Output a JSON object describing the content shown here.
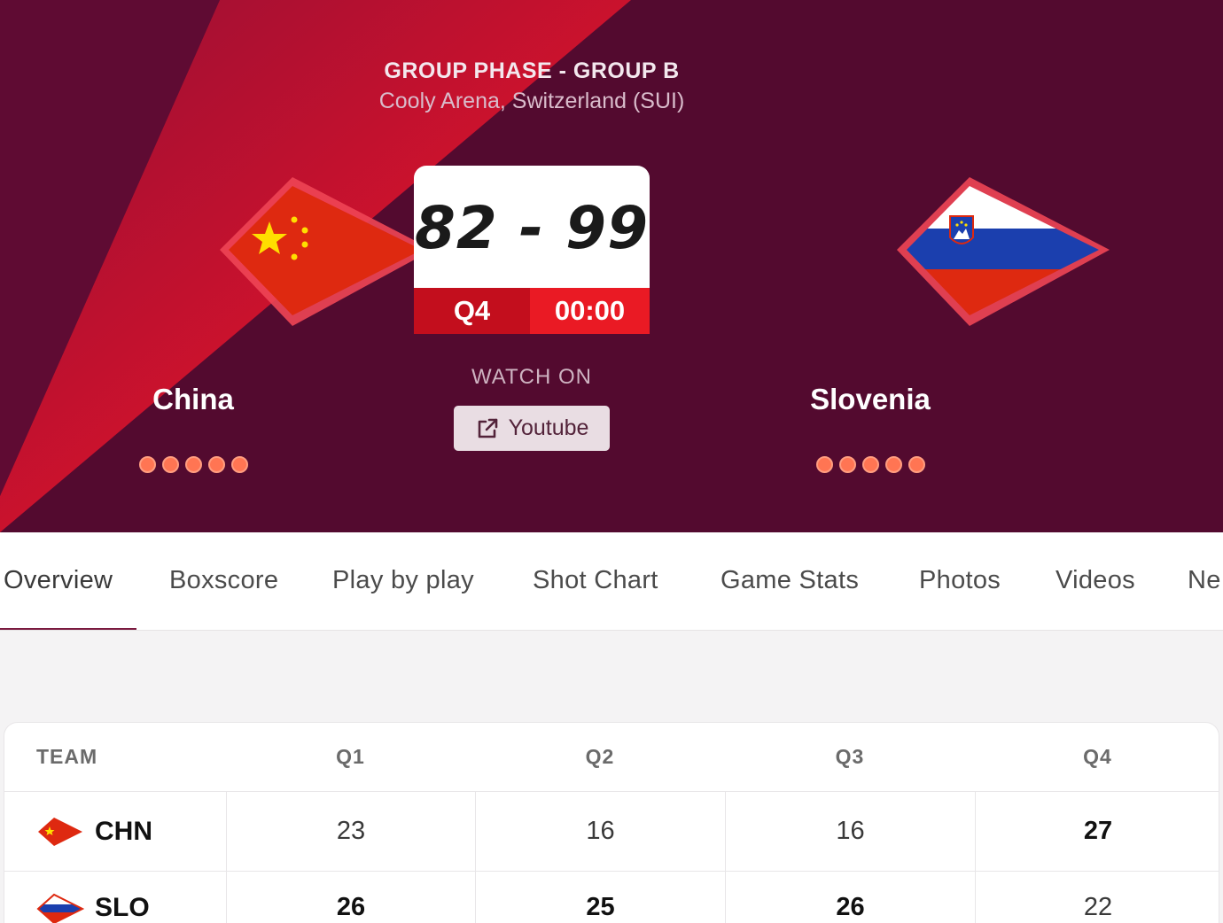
{
  "event": {
    "phase": "GROUP PHASE - GROUP B",
    "venue": "Cooly Arena, Switzerland (SUI)"
  },
  "home_team": {
    "name": "China",
    "abbr": "CHN",
    "flag_icon": "china-flag-icon",
    "color": "#de2910"
  },
  "away_team": {
    "name": "Slovenia",
    "abbr": "SLO",
    "flag_icon": "slovenia-flag-icon",
    "color": "#1b3fae"
  },
  "score": {
    "display": "82 - 99",
    "period": "Q4",
    "clock": "00:00"
  },
  "watch": {
    "label": "WATCH ON",
    "button_label": "Youtube",
    "icon": "external-link-icon"
  },
  "tabs": [
    {
      "label": "Overview",
      "active": true
    },
    {
      "label": "Boxscore"
    },
    {
      "label": "Play by play"
    },
    {
      "label": "Shot Chart"
    },
    {
      "label": "Game Stats"
    },
    {
      "label": "Photos"
    },
    {
      "label": "Videos"
    },
    {
      "label": "Ne"
    }
  ],
  "quarter_table": {
    "headers": [
      "TEAM",
      "Q1",
      "Q2",
      "Q3",
      "Q4"
    ],
    "rows": [
      {
        "team": "CHN",
        "values": [
          "23",
          "16",
          "16",
          "27"
        ]
      },
      {
        "team": "SLO",
        "values": [
          "26",
          "25",
          "26",
          "22"
        ]
      }
    ]
  },
  "colors": {
    "hero_background": "#530a2f",
    "hero_stripe": "#c8102e",
    "accent": "#7a1a3f",
    "status_red": "#ea1a24"
  }
}
